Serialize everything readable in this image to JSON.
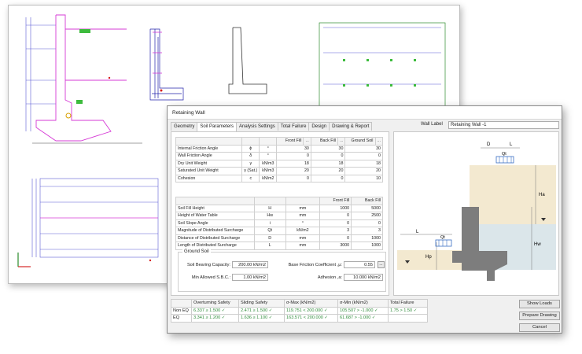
{
  "dialog": {
    "title": "Retaining Wall",
    "tabs": [
      "Geometry",
      "Soil Parameters",
      "Analysis Settings",
      "Total Failure",
      "Design",
      "Drawing & Report"
    ],
    "active_tab": "Soil Parameters",
    "wall_label_caption": "Wall Label",
    "wall_label_value": "Retaining Wall -1"
  },
  "soil_table": {
    "headers": [
      "",
      "",
      "",
      "Front Fill",
      "...",
      "Back Fill",
      "...",
      "Ground Soil",
      "..."
    ],
    "rows": [
      {
        "name": "Internal Friction Angle",
        "sym": "ϕ",
        "unit": "°",
        "front": "30",
        "back": "30",
        "ground": "30"
      },
      {
        "name": "Wall Friction Angle",
        "sym": "δ",
        "unit": "°",
        "front": "0",
        "back": "0",
        "ground": "0"
      },
      {
        "name": "Dry Unit Weight",
        "sym": "γ",
        "unit": "kN/m3",
        "front": "18",
        "back": "18",
        "ground": "18"
      },
      {
        "name": "Saturated Unit Weight",
        "sym": "γ (Sat.)",
        "unit": "kN/m3",
        "front": "20",
        "back": "20",
        "ground": "20"
      },
      {
        "name": "Cohesion",
        "sym": "c",
        "unit": "kN/m2",
        "front": "0",
        "back": "0",
        "ground": "10"
      }
    ]
  },
  "fill_table": {
    "headers": [
      "",
      "",
      "",
      "Front Fill",
      "Back Fill"
    ],
    "rows": [
      {
        "name": "Soil Fill Height",
        "sym": "H",
        "unit": "mm",
        "front": "1000",
        "back": "5000"
      },
      {
        "name": "Height of Water Table",
        "sym": "Hw",
        "unit": "mm",
        "front": "0",
        "back": "2500"
      },
      {
        "name": "Soil Slope Angle",
        "sym": "i",
        "unit": "°",
        "front": "0",
        "back": "0"
      },
      {
        "name": "Magnitude of Distributed Surcharge",
        "sym": "Qt",
        "unit": "kN/m2",
        "front": "3",
        "back": "3"
      },
      {
        "name": "Distance of Distributed Surcharge",
        "sym": "D",
        "unit": "mm",
        "front": "0",
        "back": "1000"
      },
      {
        "name": "Length of Distributed Surcharge",
        "sym": "L",
        "unit": "mm",
        "front": "3000",
        "back": "1000"
      }
    ]
  },
  "ground_soil": {
    "title": "Ground Soil",
    "bearing_label": "Soil Bearing Capacity:",
    "bearing_value": "200.00 kN/m2",
    "min_sbc_label": "Min Allowed S.B.C.:",
    "min_sbc_value": "1.00 kN/m2",
    "friction_label": "Base Friction Coefficient ,μ:",
    "friction_value": "0.55",
    "friction_btn": "...",
    "adhesion_label": "Adhesion ,a:",
    "adhesion_value": "10.000 kN/m2"
  },
  "preview": {
    "labels": {
      "d": "D",
      "l_top": "L",
      "qt_top": "Qt",
      "l_left": "L",
      "qt_left": "Qt",
      "ha": "Ha",
      "hw": "Hw",
      "hp": "Hp"
    },
    "colors": {
      "soil": "#f3e9d0",
      "water": "#dbe6ea",
      "wall": "#7d7d7d",
      "surcharge": "#3a6fc4"
    }
  },
  "results": {
    "headers": [
      "",
      "Overturning Safety",
      "Sliding Safety",
      "σ-Max (kN/m2)",
      "σ-Min (kN/m2)",
      "Total Failure"
    ],
    "rows": [
      {
        "case": "Non EQ",
        "overturning": "6.337 ≥ 1.500 ✓",
        "sliding": "2.471 ≥ 1.500 ✓",
        "smax": "119.751 < 200.000 ✓",
        "smin": "105.507 > -1.000 ✓",
        "total": "1.75 > 1.50 ✓"
      },
      {
        "case": "EQ",
        "overturning": "3.341 ≥ 1.200 ✓",
        "sliding": "1.636 ≥ 1.100 ✓",
        "smax": "163.571 < 200.000 ✓",
        "smin": "61.687 > -1.000 ✓",
        "total": ""
      }
    ]
  },
  "buttons": {
    "show_loads": "Show Loads",
    "prepare_drawing": "Prepare Drawing",
    "cancel": "Cancel"
  }
}
